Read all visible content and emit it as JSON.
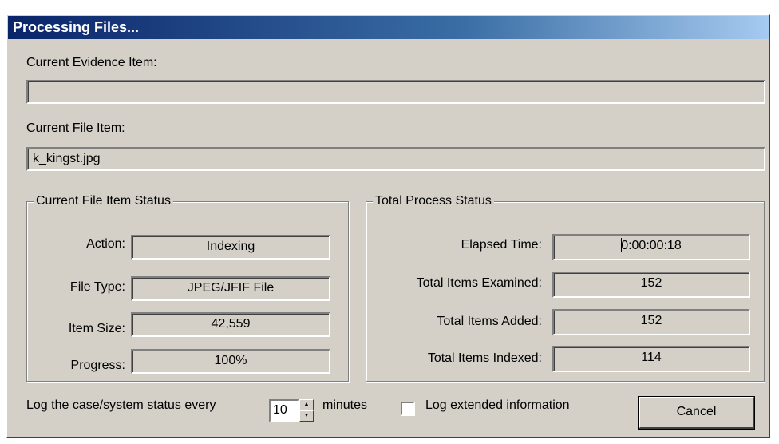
{
  "window": {
    "title": "Processing Files..."
  },
  "current_evidence_item": {
    "label": "Current Evidence Item:",
    "value": ""
  },
  "current_file_item": {
    "label": "Current File Item:",
    "value": "k_kingst.jpg"
  },
  "file_item_status": {
    "title": "Current File Item Status",
    "rows": [
      {
        "label": "Action:",
        "value": "Indexing"
      },
      {
        "label": "File Type:",
        "value": "JPEG/JFIF File"
      },
      {
        "label": "Item Size:",
        "value": "42,559"
      },
      {
        "label": "Progress:",
        "value": "100%"
      }
    ]
  },
  "total_process_status": {
    "title": "Total Process Status",
    "rows": [
      {
        "label": "Elapsed Time:",
        "value": "0:00:00:18"
      },
      {
        "label": "Total Items Examined:",
        "value": "152"
      },
      {
        "label": "Total Items Added:",
        "value": "152"
      },
      {
        "label": "Total Items Indexed:",
        "value": "114"
      }
    ]
  },
  "footer": {
    "log_label": "Log the case/system status every",
    "log_interval": "10",
    "minutes_label": "minutes",
    "extended_label": "Log extended information",
    "extended_checked": false,
    "cancel_label": "Cancel"
  },
  "colors": {
    "dialog_face": "#d4d0c8",
    "titlebar_start": "#0a246a",
    "titlebar_end": "#a6caf0",
    "titlebar_text": "#ffffff"
  }
}
